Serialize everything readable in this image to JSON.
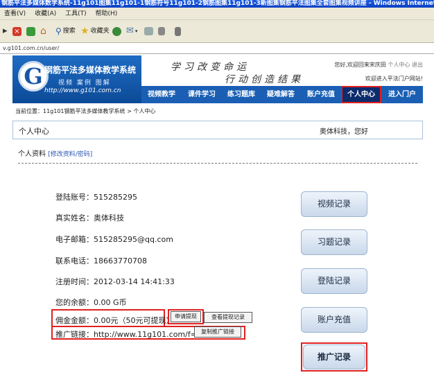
{
  "window": {
    "title": "钢筋平法多媒体数学系统-11g101图集11g101-1钢筋符号11g101-2钢筋图集11g101-3新图集钢筋平法图集全套图集视频讲座 - Windows Internet Explorer"
  },
  "menu": [
    "查看(V)",
    "收藏(A)",
    "工具(T)",
    "帮助(H)"
  ],
  "toolbar": {
    "search": "搜索",
    "favorites": "收藏夹"
  },
  "address": "v.g101.com.cn/user/",
  "logo": {
    "title": "钢筋平法多媒体教学系统",
    "sub": "视频  案例  图解",
    "url": "http://www.g101.com.cn"
  },
  "slogan": {
    "line1": "学习改变命运",
    "line2": "行动创造结果"
  },
  "welcome": {
    "text": "您好,欢迎回来宋庆田",
    "center": "个人中心",
    "logout": "退出",
    "line2": "欢迎进入平法门户网站!"
  },
  "nav": [
    "视频教学",
    "课件学习",
    "练习题库",
    "疑难解答",
    "账户充值",
    "个人中心",
    "进入门户"
  ],
  "breadcrumb": "当前位置：11g101钢筋平法多媒体教学系统 > 个人中心",
  "center": {
    "title": "个人中心",
    "user": "奥体科技，您好"
  },
  "section": {
    "title": "个人资料",
    "edit": "[修改资料/密码]"
  },
  "profile": {
    "account": "登陆账号：515285295",
    "name": "真实姓名：奥体科技",
    "email": "电子邮箱：515285295@qq.com",
    "phone": "联系电话：18663770708",
    "reg": "注册时间：2012-03-14 14:41:33",
    "balance": "您的余额：0.00 G币",
    "commission": "佣金金额：0.00元（50元可提现）",
    "promo": "推广链接：http://www.11g101.com/f=***"
  },
  "buttons": {
    "apply": "申请提现",
    "view": "查看提现记录",
    "copy": "复制推广链接"
  },
  "side": [
    "视频记录",
    "习题记录",
    "登陆记录",
    "账户充值",
    "推广记录"
  ]
}
